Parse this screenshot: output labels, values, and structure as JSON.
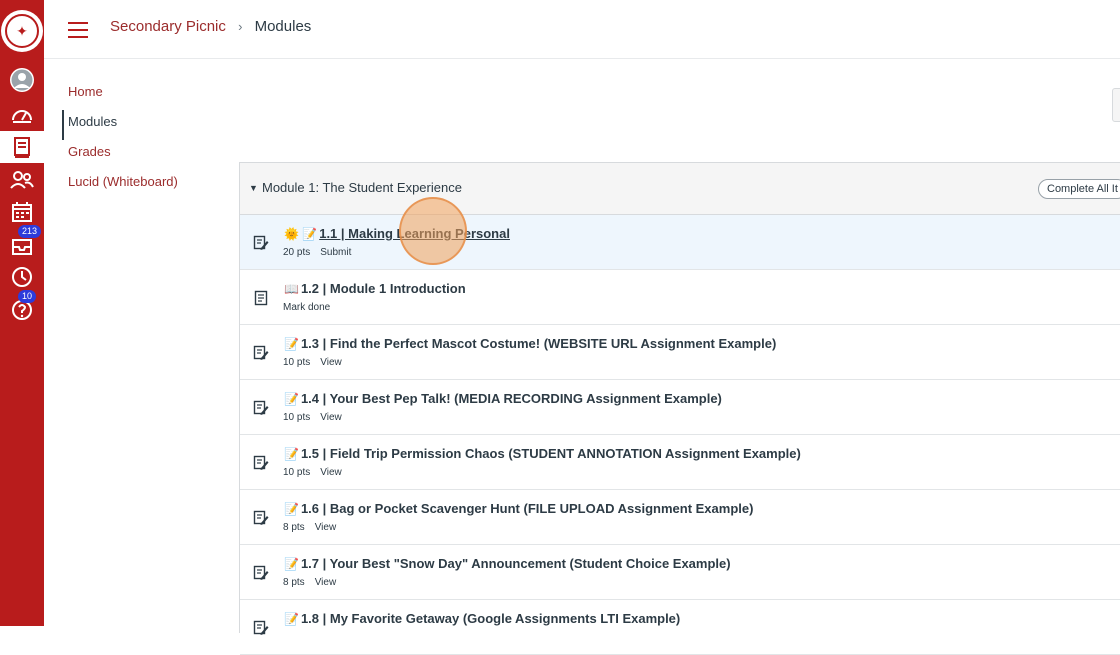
{
  "header": {
    "breadcrumb_course": "Secondary Picnic",
    "breadcrumb_separator": "›",
    "breadcrumb_current": "Modules"
  },
  "global_nav": {
    "items": [
      {
        "icon": "user-avatar-icon"
      },
      {
        "icon": "dashboard-icon"
      },
      {
        "icon": "courses-icon",
        "active": true
      },
      {
        "icon": "groups-icon"
      },
      {
        "icon": "calendar-icon"
      },
      {
        "icon": "inbox-icon",
        "badge": "213"
      },
      {
        "icon": "history-icon"
      },
      {
        "icon": "help-icon",
        "badge": "10"
      }
    ]
  },
  "course_nav": {
    "items": [
      {
        "label": "Home"
      },
      {
        "label": "Modules",
        "active": true
      },
      {
        "label": "Grades"
      },
      {
        "label": "Lucid (Whiteboard)"
      }
    ]
  },
  "module": {
    "title": "Module 1: The Student Experience",
    "complete_label": "Complete All It",
    "items": [
      {
        "emoji": "🌞 📝",
        "title": "1.1 | Making Learning Personal",
        "pts": "20 pts",
        "action": "Submit",
        "type": "assignment",
        "highlight": true
      },
      {
        "emoji": "📖",
        "title": "1.2 | Module 1 Introduction",
        "pts": "",
        "action": "Mark done",
        "type": "page"
      },
      {
        "emoji": "📝",
        "title": "1.3 | Find the Perfect Mascot Costume! (WEBSITE URL Assignment Example)",
        "pts": "10 pts",
        "action": "View",
        "type": "assignment"
      },
      {
        "emoji": "📝",
        "title": "1.4 | Your Best Pep Talk! (MEDIA RECORDING Assignment Example)",
        "pts": "10 pts",
        "action": "View",
        "type": "assignment"
      },
      {
        "emoji": "📝",
        "title": "1.5 | Field Trip Permission Chaos (STUDENT ANNOTATION Assignment Example)",
        "pts": "10 pts",
        "action": "View",
        "type": "assignment"
      },
      {
        "emoji": "📝",
        "title": "1.6 | Bag or Pocket Scavenger Hunt (FILE UPLOAD Assignment Example)",
        "pts": "8 pts",
        "action": "View",
        "type": "assignment"
      },
      {
        "emoji": "📝",
        "title": "1.7 | Your Best \"Snow Day\" Announcement (Student Choice Example)",
        "pts": "8 pts",
        "action": "View",
        "type": "assignment"
      },
      {
        "emoji": "📝",
        "title": "1.8 | My Favorite Getaway (Google Assignments LTI Example)",
        "pts": "",
        "action": "",
        "type": "assignment"
      }
    ]
  },
  "colors": {
    "brand_red": "#b81c1c",
    "link_red": "#9b2c2c",
    "highlight_row": "#eef6fd",
    "badge_blue": "#2d3bdb"
  }
}
